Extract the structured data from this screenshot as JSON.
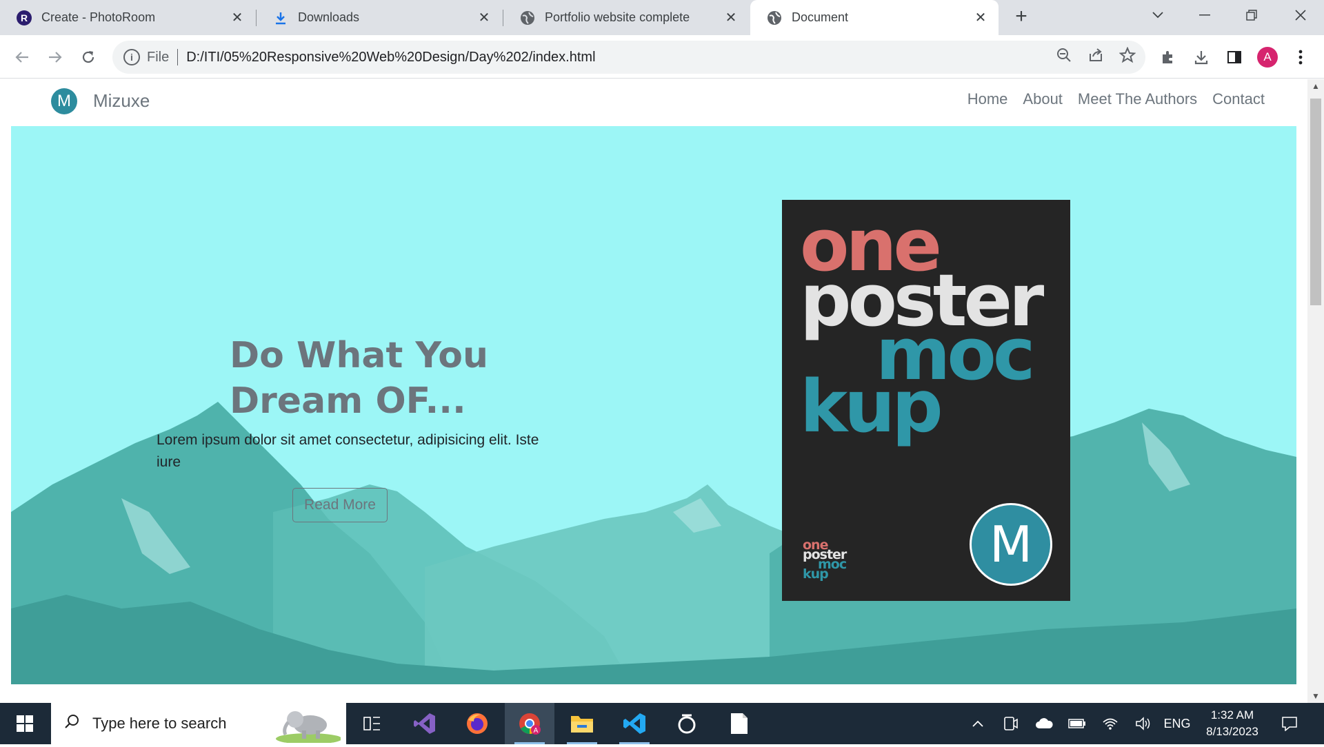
{
  "browser": {
    "tabs": [
      {
        "title": "Create - PhotoRoom",
        "icon": "photoroom-icon",
        "active": false
      },
      {
        "title": "Downloads",
        "icon": "download-icon",
        "active": false
      },
      {
        "title": "Portfolio website complete",
        "icon": "globe-icon",
        "active": false
      },
      {
        "title": "Document",
        "icon": "globe-icon",
        "active": true
      }
    ],
    "address": {
      "scheme": "File",
      "url": "D:/ITI/05%20Responsive%20Web%20Design/Day%202/index.html"
    },
    "profile_initial": "A",
    "profile_color": "#d6246e"
  },
  "page": {
    "brand": {
      "logo_letter": "M",
      "name": "Mizuxe"
    },
    "nav": [
      "Home",
      "About",
      "Meet The Authors",
      "Contact"
    ],
    "hero": {
      "title": "Do What You Dream OF...",
      "text": "Lorem ipsum dolor sit amet consectetur, adipisicing elit. Iste iure",
      "button": "Read More"
    },
    "poster": {
      "words": [
        "one",
        "poster",
        "moc",
        "kup"
      ],
      "small_words": [
        "one",
        "poster",
        "moc",
        "kup"
      ],
      "badge_letter": "M"
    },
    "colors": {
      "hero_bg": "#9cf6f6",
      "accent": "#2f97a8",
      "coral": "#d9716d"
    }
  },
  "taskbar": {
    "search_placeholder": "Type here to search",
    "apps": [
      "task-view-icon",
      "visual-studio-icon",
      "firefox-icon",
      "chrome-icon",
      "file-explorer-icon",
      "vscode-icon",
      "obs-icon",
      "notepad-icon"
    ],
    "language": "ENG",
    "time": "1:32 AM",
    "date": "8/13/2023"
  }
}
